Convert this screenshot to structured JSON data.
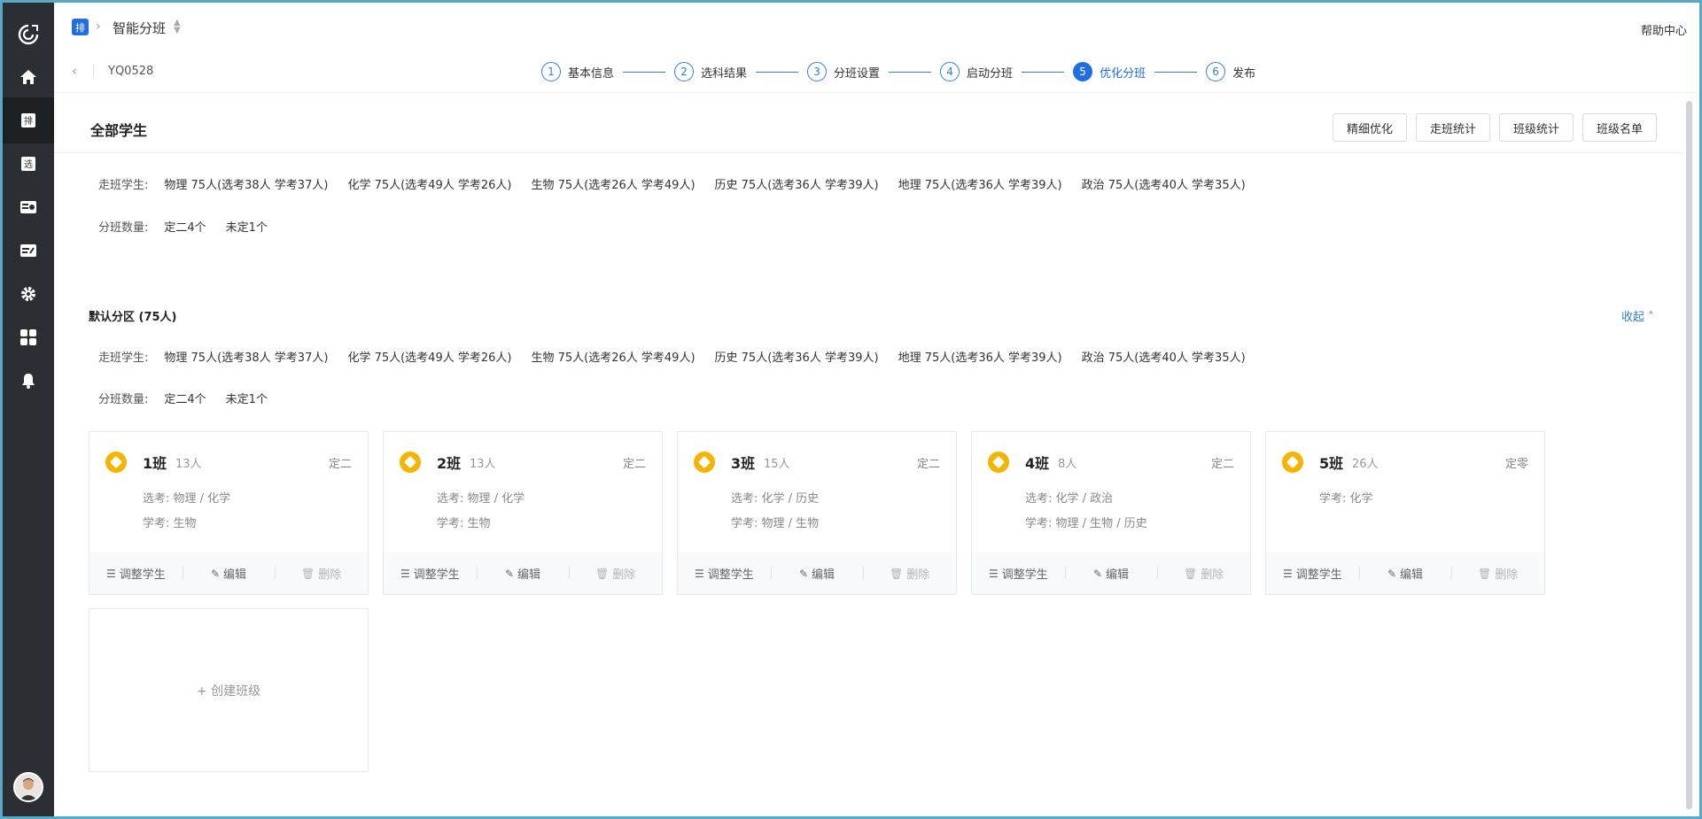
{
  "topbar": {
    "app_badge": "排",
    "title": "智能分班",
    "help": "帮助中心"
  },
  "subbar": {
    "code": "YQ0528",
    "steps": [
      {
        "num": "1",
        "label": "基本信息"
      },
      {
        "num": "2",
        "label": "选科结果"
      },
      {
        "num": "3",
        "label": "分班设置"
      },
      {
        "num": "4",
        "label": "启动分班"
      },
      {
        "num": "5",
        "label": "优化分班"
      },
      {
        "num": "6",
        "label": "发布"
      }
    ],
    "active_step": 5
  },
  "main": {
    "title": "全部学生",
    "buttons": [
      "精细优化",
      "走班统计",
      "班级统计",
      "班级名单"
    ],
    "students_label": "走班学生:",
    "subjects": [
      "物理 75人(选考38人 学考37人)",
      "化学 75人(选考49人 学考26人)",
      "生物 75人(选考26人 学考49人)",
      "历史 75人(选考36人 学考39人)",
      "地理 75人(选考36人 学考39人)",
      "政治 75人(选考40人 学考35人)"
    ],
    "count_label": "分班数量:",
    "counts": [
      "定二4个",
      "未定1个"
    ]
  },
  "zone": {
    "title": "默认分区 (75人)",
    "collapse": "收起",
    "students_label": "走班学生:",
    "subjects": [
      "物理 75人(选考38人 学考37人)",
      "化学 75人(选考49人 学考26人)",
      "生物 75人(选考26人 学考49人)",
      "历史 75人(选考36人 学考39人)",
      "地理 75人(选考36人 学考39人)",
      "政治 75人(选考40人 学考35人)"
    ],
    "count_label": "分班数量:",
    "counts": [
      "定二4个",
      "未定1个"
    ]
  },
  "classes": [
    {
      "name": "1班",
      "count": "13人",
      "type": "定二",
      "line1": "选考: 物理 / 化学",
      "line2": "学考: 生物"
    },
    {
      "name": "2班",
      "count": "13人",
      "type": "定二",
      "line1": "选考: 物理 / 化学",
      "line2": "学考: 生物"
    },
    {
      "name": "3班",
      "count": "15人",
      "type": "定二",
      "line1": "选考: 化学 / 历史",
      "line2": "学考: 物理 / 生物"
    },
    {
      "name": "4班",
      "count": "8人",
      "type": "定二",
      "line1": "选考: 化学 / 政治",
      "line2": "学考: 物理 / 生物 / 历史"
    },
    {
      "name": "5班",
      "count": "26人",
      "type": "定零",
      "line1": "学考: 化学",
      "line2": ""
    }
  ],
  "card_actions": {
    "adjust": "调整学生",
    "edit": "编辑",
    "delete": "删除"
  },
  "create_class": "+ 创建班级",
  "colors": {
    "primary": "#1f6fe0",
    "sidebar": "#2b2f33",
    "badge": "#f4b400"
  }
}
